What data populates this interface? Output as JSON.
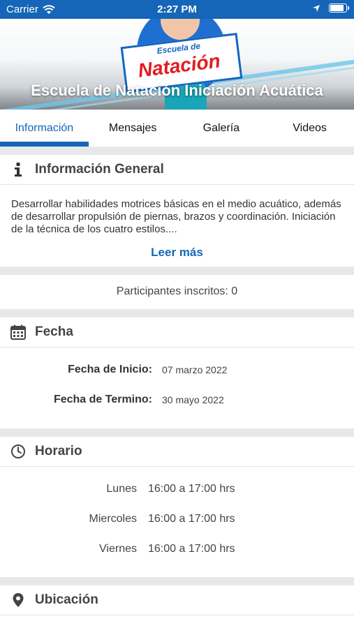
{
  "status_bar": {
    "carrier": "Carrier",
    "time": "2:27 PM"
  },
  "hero": {
    "title": "Escuela de Natación Iniciación Acuática",
    "logo_small": "Escuela de",
    "logo_big": "Natación"
  },
  "tabs": [
    {
      "label": "Información",
      "active": true
    },
    {
      "label": "Mensajes",
      "active": false
    },
    {
      "label": "Galería",
      "active": false
    },
    {
      "label": "Videos",
      "active": false
    }
  ],
  "info": {
    "heading": "Información General",
    "description": "Desarrollar habilidades motrices básicas en el medio acuático, además de desarrollar propulsión de piernas, brazos y coordinación. Iniciación de la técnica de los cuatro estilos....",
    "read_more": "Leer más"
  },
  "participants": "Participantes inscritos: 0",
  "fecha": {
    "heading": "Fecha",
    "start_label": "Fecha de Inicio:",
    "start_value": "07 marzo 2022",
    "end_label": "Fecha de Termino:",
    "end_value": "30 mayo 2022"
  },
  "horario": {
    "heading": "Horario",
    "rows": [
      {
        "day": "Lunes",
        "time": "16:00 a 17:00 hrs"
      },
      {
        "day": "Miercoles",
        "time": "16:00 a 17:00 hrs"
      },
      {
        "day": "Viernes",
        "time": "16:00 a 17:00 hrs"
      }
    ]
  },
  "ubicacion": {
    "heading": "Ubicación"
  },
  "colors": {
    "primary": "#1565b8",
    "band": "#e6e8ea"
  },
  "icons": [
    "wifi-icon",
    "location-arrow-icon",
    "battery-icon",
    "info-icon",
    "calendar-icon",
    "clock-icon",
    "map-pin-icon"
  ]
}
